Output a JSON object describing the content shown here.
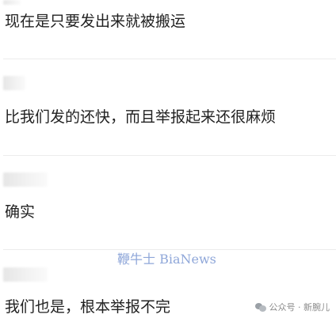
{
  "comments": [
    {
      "text": "现在是只要发出来就被搬运"
    },
    {
      "text": "比我们发的还快，而且举报起来还很麻烦"
    },
    {
      "text": "确实"
    },
    {
      "text": "我们也是，根本举报不完"
    }
  ],
  "watermark": "鞭牛士 BiaNews",
  "attribution": "公众号 · 新腕儿",
  "icons": {
    "attribution_icon": "wechat-icon"
  }
}
